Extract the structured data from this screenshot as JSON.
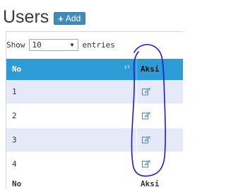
{
  "header": {
    "title": "Users",
    "add_icon": "plus-icon",
    "add_label": "Add"
  },
  "length": {
    "show_label": "Show",
    "selected": "10",
    "entries_label": "entries"
  },
  "table": {
    "columns": [
      "No",
      "Aksi"
    ],
    "sort_icon": "sort-icon",
    "rows": [
      {
        "no": "1",
        "action_icon": "edit-icon"
      },
      {
        "no": "2",
        "action_icon": "edit-icon"
      },
      {
        "no": "3",
        "action_icon": "edit-icon"
      },
      {
        "no": "4",
        "action_icon": "edit-icon"
      }
    ],
    "footer": [
      "No",
      "Aksi"
    ]
  },
  "colors": {
    "header_bg": "#2d9bd6",
    "add_button_bg": "#3c8dbc",
    "odd_row_bg": "#e6e9f7",
    "annotation_stroke": "#1a1ad6"
  }
}
